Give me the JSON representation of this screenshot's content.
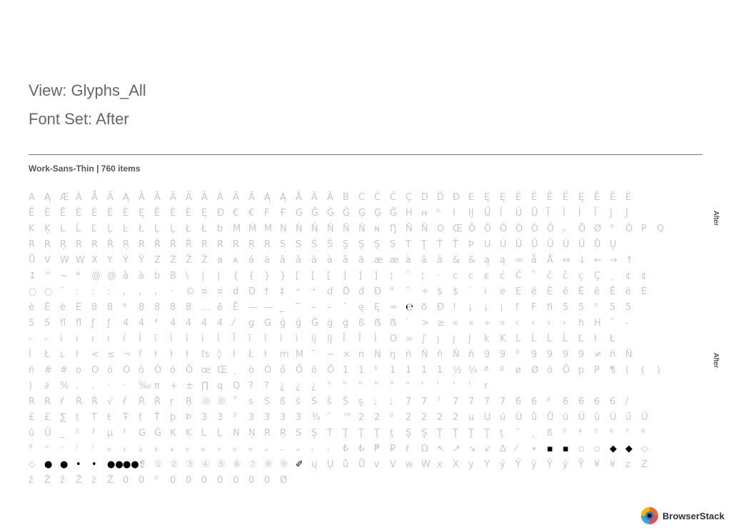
{
  "view_title": "View: Glyphs_All",
  "font_set_title": "Font Set: After",
  "section_label": "Work-Sans-Thin | 760 items",
  "side_label": "After",
  "brand": "BrowserStack",
  "glyph_rows": [
    "A Ą Æ Á Ǟ Ä Ą Â Ā Ä Ä Ä À Ā Ā Ą Ą Å Ã Ă B C Ć Č Ç D Ď Đ E Ę Ę É Ě Ê Ě Ę Ê Ê È",
    "Ë Ė Ē È Ė Ė È Ę Ë Ė Ė Ę Ð € € F Ғ G Ğ Ġ Ĝ Ģ Ģ Ğ H ʜ ʰ I IJ Ü Í Ü Ű Ī Ì Ì Î J J",
    "K Ķ L Ĺ Ľ Ļ Ŀ Ł Ļ Ļ Ł Ł ƅ M Ṁ M N Ń Ň Ñ Ñ Ň ɴ Ŋ Ñ Ň O Œ Ö Ô Ô Ö Ô Ö ₒ Ō Ø ° Ô P Q",
    "R R Ŗ R R Ř Ŗ R Ř Ř Ř R R R Ŗ R S S Ś Š Ş Ş Ș S T Ţ Ť Ť Þ U Ú Ü Ū Ü Ù Ű Ů Ų",
    "Ů V W W X Y Ý Ÿ Z Ź Ž Ż a ᴀ á ă â ǎ ä à ǎ ä æ æ à ā ǎ & & ą ą ≈ å Ǻ ⇔ ↓ ← → ↑",
    "↕ ^ ~ * @ @ ã ă b B \\ | | { { } } [ [ [ ] ] ] ¦ ˘ ¦ · c c ȼ ć Č ˇ č č ç Ç ¸ ¢ ¢",
    "○ ○ ˆ : : : , , , · © ¤ ¤ d D † ‡ ⁼ ⁺ ď Ď đ Đ ° ˜ ÷ $ $ ˙ i e E é É ě Ě ê Ê è É",
    "ė Ė è È 8 8 ⁸ 8 8 8 8 … ē Ē — — _ ‾ – – ˉ ę Ę = ℮ ð Đ ! ¡ ¡ ¡ f F fi 5 5 ⁵ 5 5",
    "5 5 fl fl ƒ ƒ 4 4 ⁴ 4 4 4 4 ⁄ g G ğ ğ Ğ ġ ģ ß ẞ ẞ ` > ≥ « « » » ‹ ‹ › › h H ˝ -",
    "- ‐ i ı ı ı í Í ĭ ĭ ï ì î Ĩ ĭ ï ì ì ij IJ Ī Ï Ì O ∞ ∫ ȷ ȷ J k K L Ĺ Ĺ Ĺ Ľ ł Ł",
    "ĺ Ł ʟ ł < ≤ ¬ ſ ŀ ŀ ŀ ſs ◊ ł Ł ł m M ¯ − × n N ŋ ń Ń ň Ň ň 9 9 ⁹ 9 9 9 9 ≠ ñ Ñ",
    "ñ # # o O ó Ó ô Ô ö Ö œ Œ ˛ ò Ò ő Ő ō Ō 1 1 ¹ 1 1 1 1 ½ ¼ ª º ø Ø õ Õ p P ¶ ( ( )",
    ") ∂ % . . · · ‰ π + ± ∏ q Q ? ? ¿ ¿ ¿ \" \" \" \" \" \" ' ' ' ' r",
    "R R ŕ Ŕ Ŕ √ ř Ř Ř ŗ Ŗ ® ® ˚ s S ß ś Ś š Š ş ; ; 7 7 ⁷ 7 7 7 7 6 6 ⁶ 6 6 6 6 /",
    "£ £ ∑ t T ŧ Ŧ ť Ť þ Þ 3 3 ³ 3 3 3 3 ¾ ˜ ™ 2 2 ² 2 2 2 2 u U ú Ú ů Ů ü Ü ù Ù ű Ű",
    "ū Ū _ ² ³ µ ¹ G Ǧ K Ķ L Ļ N Ņ R Ŗ S Ş T Ţ Ţ Ţ ţ Ş Ş Ţ Ţ Ţ Ţ ţ ˜ ˛ ß ⁰ ⁴ ⁵ ⁶ ⁷ ⁸",
    "⁹ ⁼ ⁻ ⁽ ⁾ ₀ ₁ ₂ ₃ ₄ ₅ ₆ ₇ ₈ ₉ ₊ ₋ ₌ ₍ ₎ ₺ ₺ ₱ ₽ ℓ Ω ↖ ↗ ↘ ↙ ∆ ⁄ ∙ ▪ ▪ ▫ ▫ ◆ ◆ ◇",
    "◇ ● ● • • ●● ●● ❡ ① ② ③ ④ ⑤ ⑥ ⑦ ⑧ ⑨ ✐ ų Ų ů Ů v V w W x X y Y ý Ý ÿ Ÿ ÿ Ÿ ¥ ¥ z Z",
    "ź Ź ž Ž ż Ż 0 0 ⁰ 0 0 0 0 0 0 0 Ø"
  ],
  "dark_glyphs": [
    "▪",
    "◆",
    "●",
    "•",
    "●●",
    "✐",
    "℮"
  ]
}
